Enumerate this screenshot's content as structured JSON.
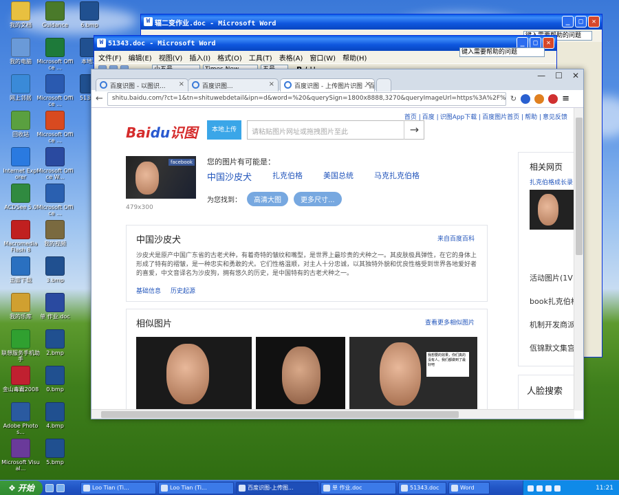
{
  "desktop_icons": [
    {
      "label": "我的文档",
      "color": "#e8c040"
    },
    {
      "label": "Guidance",
      "color": "#4a7a2a"
    },
    {
      "label": "6.bmp",
      "color": "#205090"
    },
    {
      "label": "我的电脑",
      "color": "#6a9ad8"
    },
    {
      "label": "Microsoft Office ...",
      "color": "#1e7a3a"
    },
    {
      "label": "本地...",
      "color": "#205090"
    },
    {
      "label": "网上邻居",
      "color": "#3a8ad8"
    },
    {
      "label": "Microsoft Office ...",
      "color": "#2a5ab0"
    },
    {
      "label": "5134...",
      "color": "#205090"
    },
    {
      "label": "回收站",
      "color": "#5aa040"
    },
    {
      "label": "Microsoft Office ...",
      "color": "#d84a20"
    },
    {
      "label": "Internet Explorer",
      "color": "#2a7ae0"
    },
    {
      "label": "Microsoft Office W...",
      "color": "#2a4aa0"
    },
    {
      "label": "ACDSee 5.0",
      "color": "#308a40"
    },
    {
      "label": "Microsoft Office ...",
      "color": "#2a60b0"
    },
    {
      "label": "Macromedia Flash 8",
      "color": "#c02020"
    },
    {
      "label": "我的视频",
      "color": "#7a6a40"
    },
    {
      "label": "迅雷下载",
      "color": "#2a70c0"
    },
    {
      "label": "3.bmp",
      "color": "#205090"
    },
    {
      "label": "我的乐库",
      "color": "#d0a030"
    },
    {
      "label": "单 作业.doc",
      "color": "#2a4aa0"
    },
    {
      "label": "联想服务手机助手",
      "color": "#30a030"
    },
    {
      "label": "2.bmp",
      "color": "#205090"
    },
    {
      "label": "金山毒霸2008",
      "color": "#c02030"
    },
    {
      "label": "0.bmp",
      "color": "#205090"
    },
    {
      "label": "Adobe Photos...",
      "color": "#2a5aa0"
    },
    {
      "label": "4.bmp",
      "color": "#205090"
    },
    {
      "label": "Microsoft Visual...",
      "color": "#6a3a9a"
    },
    {
      "label": "5.bmp",
      "color": "#205090"
    }
  ],
  "word_back": {
    "title": "辐二变作业.doc - Microsoft Word",
    "help_box": "键入需要帮助的问题"
  },
  "word_front": {
    "title": "51343.doc - Microsoft Word",
    "menus": [
      "文件(F)",
      "编辑(E)",
      "视图(V)",
      "插入(I)",
      "格式(O)",
      "工具(T)",
      "表格(A)",
      "窗口(W)",
      "帮助(H)"
    ],
    "help_box": "键入需要帮助的问题",
    "style": "小五号",
    "font": "Times New Roman",
    "size": "五号"
  },
  "browser": {
    "tabs": [
      "百度识图 - 以图识...",
      "百度识图...",
      "百度识图 - 上传图片识图 - 百..."
    ],
    "url": "shitu.baidu.com/?ct=1&tn=shituwebdetail&ipn=d&word=%20&querySign=1800x8888,3270&queryImageUrl=https%3A%2F%2Flekey"
  },
  "page": {
    "top_links": [
      "首页",
      "百度",
      "识图App下载",
      "百度图片首页",
      "帮助",
      "意见反馈"
    ],
    "logo_text": "识图",
    "upload_btn": "本地上传",
    "search_placeholder": "请粘贴图片网址或拖拽图片至此",
    "guess_label": "您的图片有可能是：",
    "guesses": [
      "中国沙皮犬",
      "扎克伯格",
      "美国总统",
      "马克扎克伯格"
    ],
    "size_text": "479x300",
    "find_label": "为您找到：",
    "find_btns": [
      "高清大图",
      "更多尺寸..."
    ],
    "thumb_badge": "facebook",
    "baike": {
      "title": "中国沙皮犬",
      "source": "来自百度百科",
      "text": "沙皮犬是原产中国广东省的古老犬种，有着奇特的皱纹和嘴型，是世界上最珍贵的犬种之一。其皮肤极具弹性，在它的身体上形成了特有的褶皱，是一种忠实和勇敢的犬。它们性格温顺，对主人十分忠诚，以其独特外貌和优良性格受到世界各地爱好者的喜爱，中文音译名为沙皮狗，拥有悠久的历史，是中国特有的古老犬种之一。",
      "links": [
        "基础信息",
        "历史起源"
      ]
    },
    "similar": {
      "title": "相似图片",
      "more": "查看更多相似图片",
      "bubble": "我想要的效果，你们真的没有人。我们都做到了最好吧"
    },
    "side": {
      "title": "相关网页",
      "link": "扎克伯格成长录",
      "items": [
        "活动图片(1V",
        "book扎克伯格",
        "机制开发商派",
        "佤锦默文集宫"
      ],
      "face_title": "人脸搜索"
    }
  },
  "taskbar": {
    "start": "开始",
    "tasks": [
      "Loo Tian (Ti...",
      "Loo Tian (Ti...",
      "百度识图-上传图...",
      "单 作业.doc",
      "51343.doc",
      "Word"
    ],
    "time": "11:21"
  }
}
